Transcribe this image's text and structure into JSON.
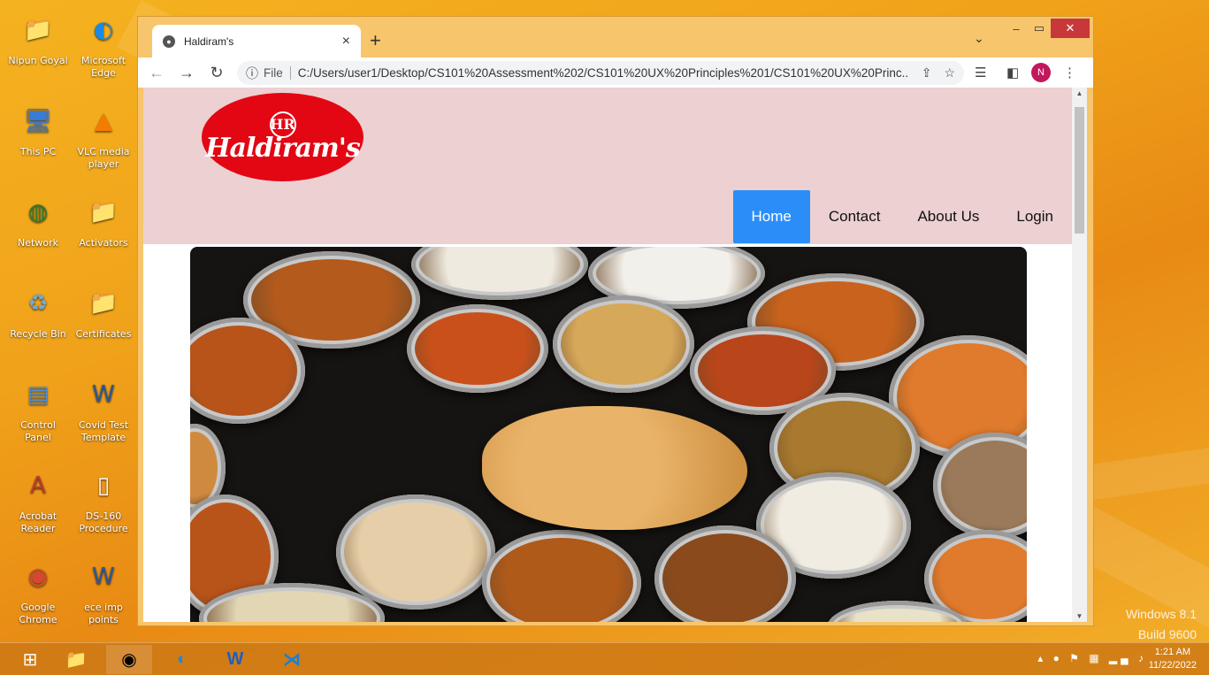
{
  "desktop": {
    "icons": [
      {
        "label": "Nipun Goyal",
        "icon": "user-folder-icon"
      },
      {
        "label": "Microsoft Edge",
        "icon": "edge-icon"
      },
      {
        "label": "This PC",
        "icon": "computer-icon"
      },
      {
        "label": "VLC media player",
        "icon": "vlc-icon"
      },
      {
        "label": "Network",
        "icon": "network-icon"
      },
      {
        "label": "Activators",
        "icon": "folder-icon"
      },
      {
        "label": "Recycle Bin",
        "icon": "recycle-bin-icon"
      },
      {
        "label": "Certificates",
        "icon": "folder-icon"
      },
      {
        "label": "Control Panel",
        "icon": "control-panel-icon"
      },
      {
        "label": "Covid Test Template",
        "icon": "word-doc-icon"
      },
      {
        "label": "Acrobat Reader",
        "icon": "acrobat-icon"
      },
      {
        "label": "DS-160 Procedure",
        "icon": "document-icon"
      },
      {
        "label": "Google Chrome",
        "icon": "chrome-icon"
      },
      {
        "label": "ece imp points",
        "icon": "word-doc-icon"
      }
    ],
    "watermark_line1": "Windows 8.1",
    "watermark_line2": "Build 9600"
  },
  "browser": {
    "tab_title": "Haldiram's",
    "tab_close": "×",
    "new_tab": "+",
    "address_scheme": "File",
    "address_url": "C:/Users/user1/Desktop/CS101%20Assessment%202/CS101%20UX%20Principles%201/CS101%20UX%20Princ...",
    "profile_initial": "N"
  },
  "site": {
    "logo_monogram": "HR",
    "logo_text": "Haldiram's",
    "nav": [
      {
        "label": "Home",
        "active": true
      },
      {
        "label": "Contact",
        "active": false
      },
      {
        "label": "About Us",
        "active": false
      },
      {
        "label": "Login",
        "active": false
      }
    ]
  },
  "taskbar": {
    "time": "1:21 AM",
    "date": "11/22/2022"
  }
}
